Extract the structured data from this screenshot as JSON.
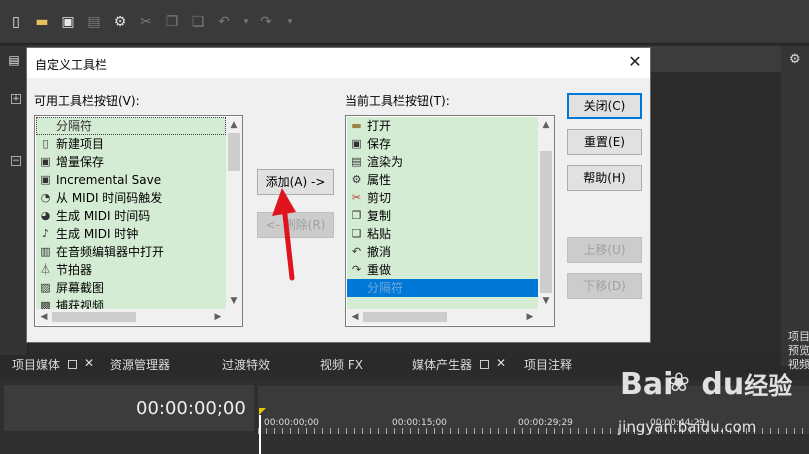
{
  "toolbar": {
    "icons": [
      "new-file-icon",
      "open-folder-icon",
      "save-icon",
      "properties-icon",
      "gear-icon",
      "cut-icon",
      "copy-icon",
      "paste-icon",
      "undo-icon",
      "dropdown-icon",
      "redo-icon",
      "dropdown-icon"
    ]
  },
  "dialog": {
    "title": "自定义工具栏",
    "close_glyph": "✕",
    "available_label": "可用工具栏按钮(V):",
    "current_label": "当前工具栏按钮(T):",
    "available_items": [
      {
        "label": "分隔符",
        "icon": "separator"
      },
      {
        "label": "新建项目",
        "icon": "new-file-icon"
      },
      {
        "label": "增量保存",
        "icon": "save-icon"
      },
      {
        "label": "Incremental Save",
        "icon": "save-icon"
      },
      {
        "label": "从 MIDI 时间码触发",
        "icon": "midi-trigger-icon"
      },
      {
        "label": "生成 MIDI 时间码",
        "icon": "midi-timecode-icon"
      },
      {
        "label": "生成 MIDI 时钟",
        "icon": "midi-clock-icon"
      },
      {
        "label": "在音频编辑器中打开",
        "icon": "audio-editor-icon"
      },
      {
        "label": "节拍器",
        "icon": "metronome-icon"
      },
      {
        "label": "屏幕截图",
        "icon": "screenshot-icon"
      },
      {
        "label": "捕获视频",
        "icon": "capture-video-icon"
      }
    ],
    "current_items": [
      {
        "label": "打开",
        "icon": "open-folder-icon"
      },
      {
        "label": "保存",
        "icon": "save-icon"
      },
      {
        "label": "渲染为",
        "icon": "render-icon"
      },
      {
        "label": "属性",
        "icon": "gear-icon"
      },
      {
        "label": "剪切",
        "icon": "cut-icon"
      },
      {
        "label": "复制",
        "icon": "copy-icon"
      },
      {
        "label": "粘贴",
        "icon": "paste-icon"
      },
      {
        "label": "撤消",
        "icon": "undo-icon"
      },
      {
        "label": "重做",
        "icon": "redo-icon"
      },
      {
        "label": "分隔符",
        "icon": "separator"
      }
    ],
    "add_button": "添加(A) ->",
    "remove_button": "<- 删除(R)",
    "close_button": "关闭(C)",
    "reset_button": "重置(E)",
    "help_button": "帮助(H)",
    "move_up_button": "上移(U)",
    "move_down_button": "下移(D)"
  },
  "tabs": [
    {
      "label": "项目媒体"
    },
    {
      "label": "资源管理器"
    },
    {
      "label": "过渡特效"
    },
    {
      "label": "视频 FX"
    },
    {
      "label": "媒体产生器"
    },
    {
      "label": "项目注释"
    }
  ],
  "timeline": {
    "timecode": "00:00:00;00",
    "ruler_labels": [
      "00:00:00;00",
      "00:00:15;00",
      "00:00:29;29",
      "00:00:44;29"
    ]
  },
  "right_panel": {
    "text_lines": [
      "项目",
      "预览",
      "视频"
    ]
  },
  "watermark": {
    "brand": "Bai",
    "brand_suffix": "du",
    "product": "经验",
    "url": "jingyan.baidu.com"
  }
}
